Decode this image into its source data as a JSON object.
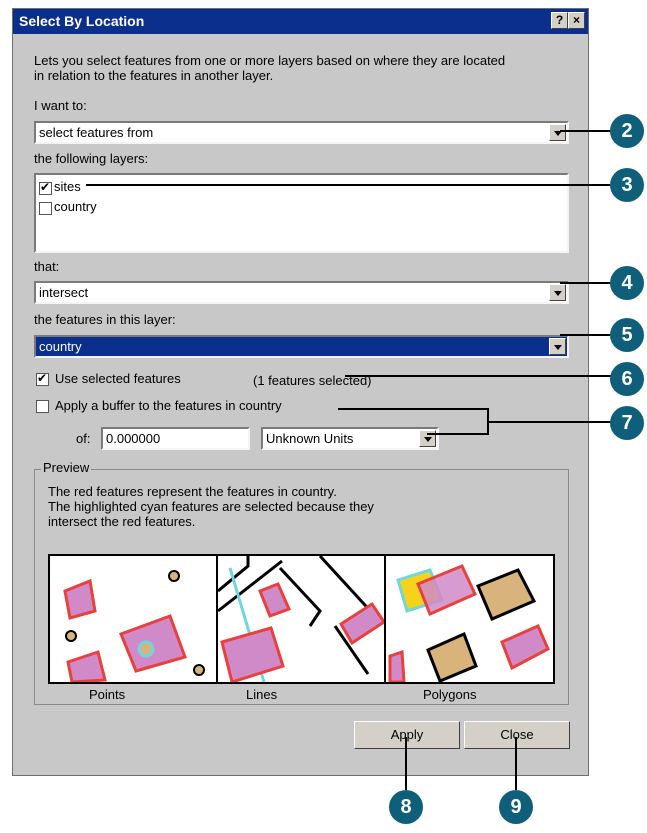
{
  "window": {
    "title": "Select By Location",
    "help_label": "?",
    "close_label": "×"
  },
  "description": [
    "Lets you select features from one or more layers based on where they are located",
    "in relation to the features in another layer."
  ],
  "i_want_to": {
    "label": "I want to:",
    "value": "select features from"
  },
  "layers": {
    "label": "the following layers:",
    "items": [
      {
        "label": "sites",
        "checked": true
      },
      {
        "label": "country",
        "checked": false
      }
    ]
  },
  "relation": {
    "label": "that:",
    "value": "intersect"
  },
  "source_layer": {
    "label": "the features in this layer:",
    "value": "country"
  },
  "use_selected": {
    "label": "Use selected features",
    "checked": true,
    "status": "(1 features selected)"
  },
  "buffer": {
    "label": "Apply a buffer to the features in  country",
    "checked": false,
    "of_label": "of:",
    "value": "0.000000",
    "units": "Unknown Units"
  },
  "preview": {
    "group_label": "Preview",
    "text": [
      "The red features represent the features in country.",
      "The highlighted cyan features are selected because they",
      "intersect the red features."
    ],
    "panels": [
      "Points",
      "Lines",
      "Polygons"
    ]
  },
  "buttons": {
    "apply": "Apply",
    "close": "Close"
  },
  "callouts": [
    "2",
    "3",
    "4",
    "5",
    "6",
    "7",
    "8",
    "9"
  ],
  "colors": {
    "title_bar": "#0b2f8c",
    "callout": "#0f5f7a",
    "red": "#e8413c",
    "cyan": "#6fd6de",
    "pink": "#d08ac8",
    "tan": "#d9b37c",
    "yellow": "#f5d21b"
  }
}
